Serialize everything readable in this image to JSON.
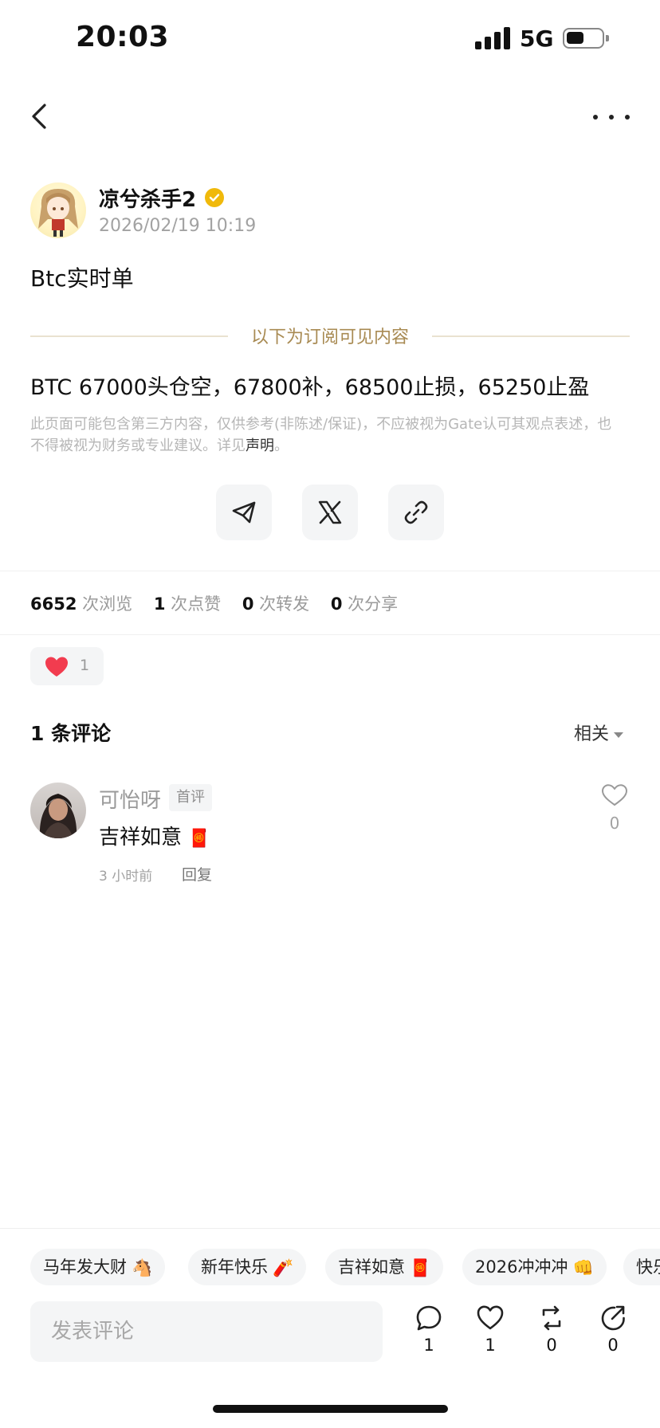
{
  "status_bar": {
    "time": "20:03",
    "network": "5G",
    "battery_level": 0.5
  },
  "author": {
    "name": "凉兮杀手2",
    "timestamp": "2026/02/19 10:19"
  },
  "post": {
    "title": "Btc实时单",
    "subscription_divider": "以下为订阅可见内容",
    "body": "BTC 67000头仓空，67800补，68500止损，65250止盈",
    "disclaimer_text": "此页面可能包含第三方内容，仅供参考(非陈述/保证)，不应被视为Gate认可其观点表述，也不得被视为财务或专业建议。详见",
    "disclaimer_link": "声明",
    "disclaimer_end": "。"
  },
  "share": {
    "icons": [
      "telegram-icon",
      "x-icon",
      "link-icon"
    ]
  },
  "stats": {
    "views": "6652",
    "views_label": "次浏览",
    "likes": "1",
    "likes_label": "次点赞",
    "reposts": "0",
    "reposts_label": "次转发",
    "shares": "0",
    "shares_label": "次分享"
  },
  "reaction": {
    "icon": "heart-icon",
    "count": "1"
  },
  "comments": {
    "title": "1 条评论",
    "sort_label": "相关",
    "items": [
      {
        "username": "可怡呀",
        "tag": "首评",
        "text": "吉祥如意",
        "emoji": "🧧",
        "time": "3 小时前",
        "reply_label": "回复",
        "like_count": "0"
      }
    ]
  },
  "quick_chips": [
    {
      "label": "马年发大财",
      "emoji": "🐴"
    },
    {
      "label": "新年快乐",
      "emoji": "🧨"
    },
    {
      "label": "吉祥如意",
      "emoji": "🧧"
    },
    {
      "label": "2026冲冲冲",
      "emoji": "👊"
    },
    {
      "label": "快乐",
      "emoji": ""
    }
  ],
  "bottom_bar": {
    "input_placeholder": "发表评论",
    "comment_count": "1",
    "like_count": "1",
    "repost_count": "0",
    "share_count": "0"
  },
  "colors": {
    "accent_gold": "#a88a52",
    "verified_badge": "#f0b90b",
    "heart_red": "#f23c4f"
  }
}
